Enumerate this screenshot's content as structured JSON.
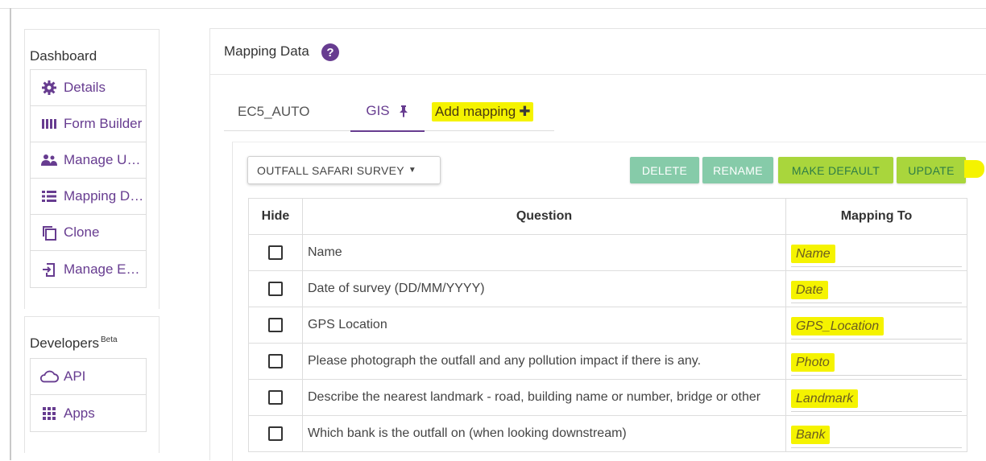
{
  "sidebar": {
    "dashboard_title": "Dashboard",
    "items": [
      {
        "label": "Details",
        "icon": "gear-icon"
      },
      {
        "label": "Form Builder",
        "icon": "form-builder-icon"
      },
      {
        "label": "Manage Users",
        "icon": "users-icon"
      },
      {
        "label": "Mapping Data",
        "icon": "list-icon"
      },
      {
        "label": "Clone",
        "icon": "clone-icon"
      },
      {
        "label": "Manage Entries",
        "icon": "import-icon"
      }
    ],
    "developers_title": "Developers",
    "developers_badge": "Beta",
    "dev_items": [
      {
        "label": "API",
        "icon": "cloud-icon"
      },
      {
        "label": "Apps",
        "icon": "apps-grid-icon"
      }
    ]
  },
  "main": {
    "title": "Mapping Data",
    "help_glyph": "?",
    "tabs": [
      {
        "label": "EC5_AUTO",
        "active": false
      },
      {
        "label": "GIS",
        "active": true,
        "pinned": true
      },
      {
        "label": "Add mapping",
        "action": true
      }
    ],
    "add_glyph": "✚",
    "dropdown_label": "OUTFALL SAFARI SURVEY",
    "buttons": {
      "delete": "DELETE",
      "rename": "RENAME",
      "make_default": "MAKE DEFAULT",
      "update": "UPDATE"
    },
    "table": {
      "headers": {
        "hide": "Hide",
        "question": "Question",
        "mapping_to": "Mapping To"
      },
      "rows": [
        {
          "question": "Name",
          "mapping": "Name"
        },
        {
          "question": "Date of survey (DD/MM/YYYY)",
          "mapping": "Date"
        },
        {
          "question": "GPS Location",
          "mapping": "GPS_Location"
        },
        {
          "question": "Please photograph the outfall and any pollution impact if there is any.",
          "mapping": "Photo"
        },
        {
          "question": "Describe the nearest landmark - road, building name or number, bridge or other",
          "mapping": "Landmark"
        },
        {
          "question": "Which bank is the outfall on (when looking downstream)",
          "mapping": "Bank"
        }
      ]
    }
  },
  "colors": {
    "brand_purple": "#673c90",
    "button_green": "#86cba9",
    "highlight_yellow": "#f5f300"
  }
}
